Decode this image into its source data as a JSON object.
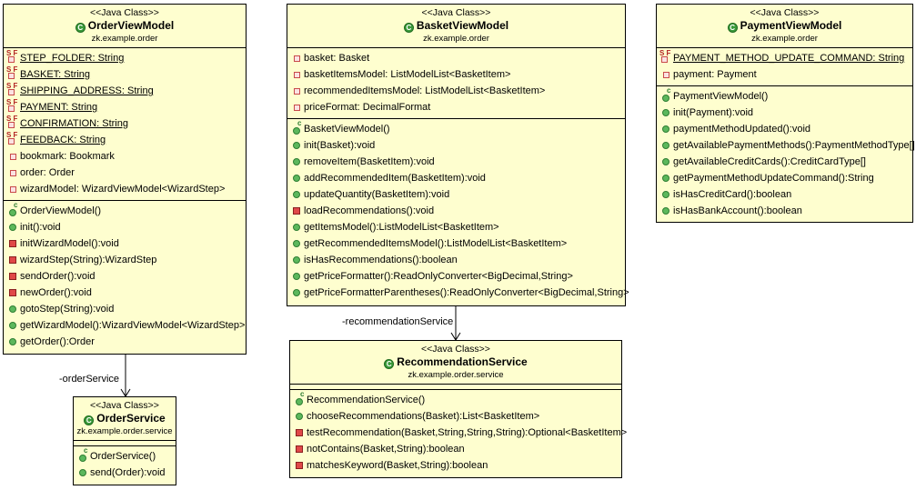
{
  "stereotype": "<<Java Class>>",
  "classes": {
    "order_vm": {
      "name": "OrderViewModel",
      "package": "zk.example.order",
      "fields": [
        "STEP_FOLDER: String",
        "BASKET: String",
        "SHIPPING_ADDRESS: String",
        "PAYMENT: String",
        "CONFIRMATION: String",
        "FEEDBACK: String",
        "bookmark: Bookmark",
        "order: Order",
        "wizardModel: WizardViewModel<WizardStep>"
      ],
      "methods": [
        "OrderViewModel()",
        "init():void",
        "initWizardModel():void",
        "wizardStep(String):WizardStep",
        "sendOrder():void",
        "newOrder():void",
        "gotoStep(String):void",
        "getWizardModel():WizardViewModel<WizardStep>",
        "getOrder():Order"
      ]
    },
    "basket_vm": {
      "name": "BasketViewModel",
      "package": "zk.example.order",
      "fields": [
        "basket: Basket",
        "basketItemsModel: ListModelList<BasketItem>",
        "recommendedItemsModel: ListModelList<BasketItem>",
        "priceFormat: DecimalFormat"
      ],
      "methods": [
        "BasketViewModel()",
        "init(Basket):void",
        "removeItem(BasketItem):void",
        "addRecommendedItem(BasketItem):void",
        "updateQuantity(BasketItem):void",
        "loadRecommendations():void",
        "getItemsModel():ListModelList<BasketItem>",
        "getRecommendedItemsModel():ListModelList<BasketItem>",
        "isHasRecommendations():boolean",
        "getPriceFormatter():ReadOnlyConverter<BigDecimal,String>",
        "getPriceFormatterParentheses():ReadOnlyConverter<BigDecimal,String>"
      ]
    },
    "payment_vm": {
      "name": "PaymentViewModel",
      "package": "zk.example.order",
      "fields": [
        "PAYMENT_METHOD_UPDATE_COMMAND: String",
        "payment: Payment"
      ],
      "methods": [
        "PaymentViewModel()",
        "init(Payment):void",
        "paymentMethodUpdated():void",
        "getAvailablePaymentMethods():PaymentMethodType[]",
        "getAvailableCreditCards():CreditCardType[]",
        "getPaymentMethodUpdateCommand():String",
        "isHasCreditCard():boolean",
        "isHasBankAccount():boolean"
      ]
    },
    "recommendation_service": {
      "name": "RecommendationService",
      "package": "zk.example.order.service",
      "fields": [],
      "methods": [
        "RecommendationService()",
        "chooseRecommendations(Basket):List<BasketItem>",
        "testRecommendation(Basket,String,String,String):Optional<BasketItem>",
        "notContains(Basket,String):boolean",
        "matchesKeyword(Basket,String):boolean"
      ]
    },
    "order_service": {
      "name": "OrderService",
      "package": "zk.example.order.service",
      "fields": [],
      "methods": [
        "OrderService()",
        "send(Order):void"
      ]
    }
  },
  "associations": {
    "order_service_label": "-orderService",
    "recommendation_service_label": "-recommendationService"
  }
}
